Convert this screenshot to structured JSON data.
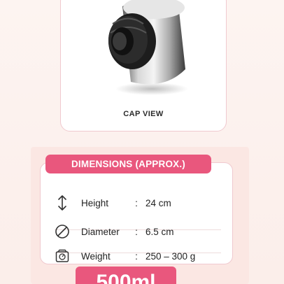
{
  "cap_card": {
    "label": "CAP VIEW"
  },
  "dimensions": {
    "title": "DIMENSIONS (APPROX.)",
    "rows": [
      {
        "icon": "height-arrow-icon",
        "label": "Height",
        "separator": ":",
        "value": "24 cm"
      },
      {
        "icon": "diameter-icon",
        "label": "Diameter",
        "separator": ":",
        "value": "6.5 cm"
      },
      {
        "icon": "weight-scale-icon",
        "label": "Weight",
        "separator": ":",
        "value": "250 – 300 g"
      }
    ]
  },
  "size_badge": {
    "label": "500ml"
  },
  "colors": {
    "accent": "#e9577d",
    "panel_bg": "#fbe7e3",
    "border": "#f0c9cf"
  }
}
